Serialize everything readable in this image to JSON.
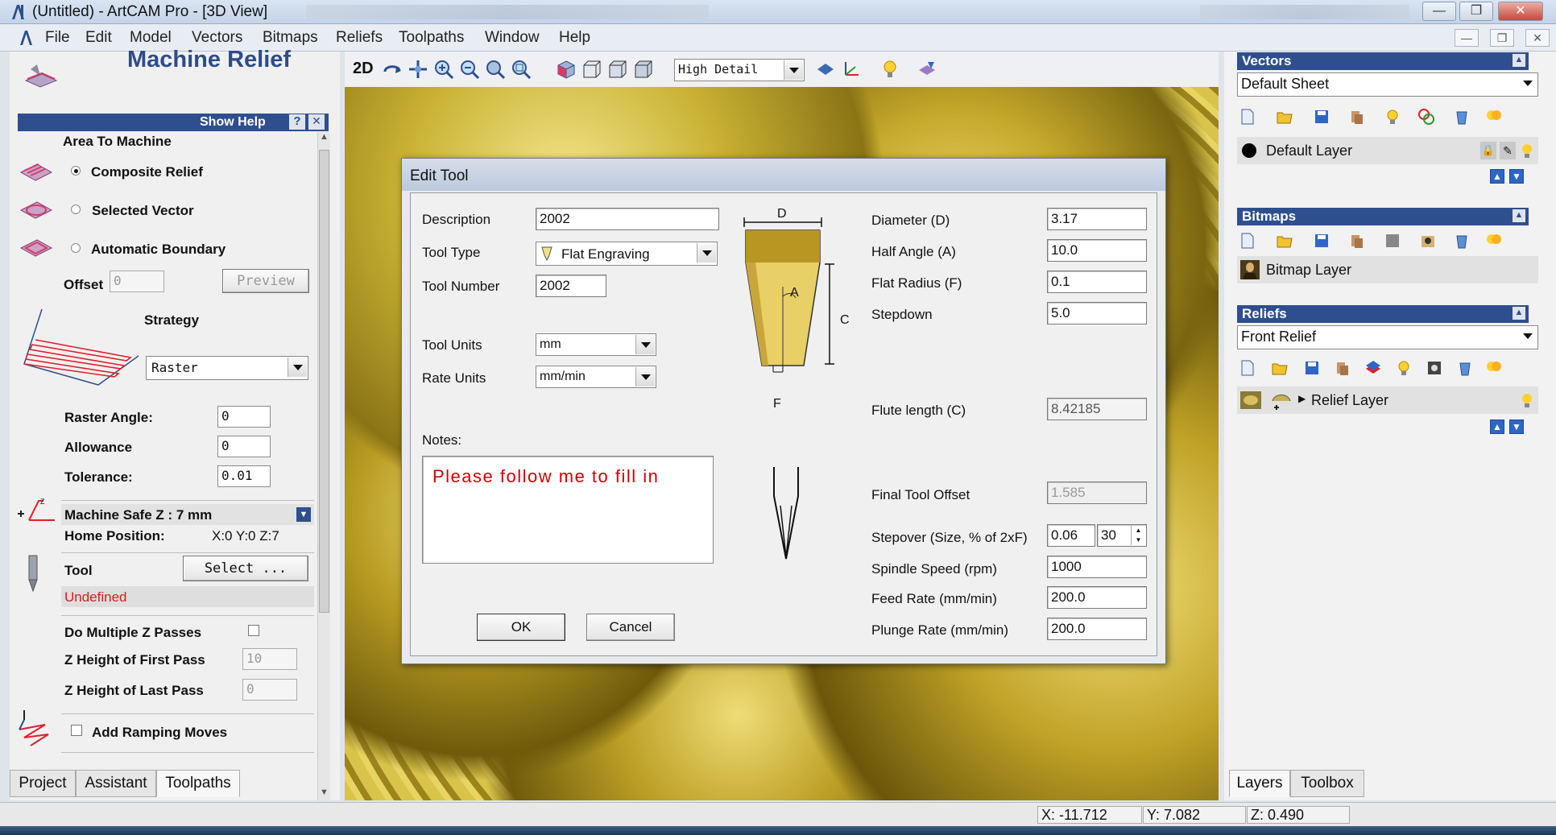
{
  "window": {
    "title": "(Untitled) - ArtCAM Pro - [3D View]",
    "minimize": "—",
    "maximize": "❐",
    "close": "✕"
  },
  "menu": [
    "File",
    "Edit",
    "Model",
    "Vectors",
    "Bitmaps",
    "Reliefs",
    "Toolpaths",
    "Window",
    "Help"
  ],
  "left": {
    "title": "Machine Relief",
    "show_help": "Show Help",
    "help_q": "?",
    "help_x": "✕",
    "area_to_machine": "Area To Machine",
    "composite_relief": "Composite Relief",
    "selected_vector": "Selected Vector",
    "automatic_boundary": "Automatic Boundary",
    "offset_label": "Offset",
    "offset_value": "0",
    "preview": "Preview",
    "strategy_label": "Strategy",
    "strategy_value": "Raster",
    "raster_angle_label": "Raster Angle:",
    "raster_angle_value": "0",
    "allowance_label": "Allowance",
    "allowance_value": "0",
    "tolerance_label": "Tolerance:",
    "tolerance_value": "0.01",
    "safe_z_label": "Machine Safe Z : 7 mm",
    "home_label": "Home Position:",
    "home_value": "X:0 Y:0 Z:7",
    "tool_label": "Tool",
    "select_button": "Select ...",
    "tool_status": "Undefined",
    "multi_z": "Do Multiple Z Passes",
    "first_pass_label": "Z Height of First Pass",
    "first_pass_value": "10",
    "last_pass_label": "Z Height of Last Pass",
    "last_pass_value": "0",
    "ramping": "Add Ramping Moves",
    "tabs": [
      "Project",
      "Assistant",
      "Toolpaths"
    ]
  },
  "toolbar": {
    "mode_2d": "2D",
    "detail": "High Detail"
  },
  "dialog": {
    "title": "Edit Tool",
    "description_label": "Description",
    "description_value": "2002",
    "tool_type_label": "Tool Type",
    "tool_type_value": "Flat Engraving",
    "tool_number_label": "Tool Number",
    "tool_number_value": "2002",
    "tool_units_label": "Tool Units",
    "tool_units_value": "mm",
    "rate_units_label": "Rate Units",
    "rate_units_value": "mm/min",
    "notes_label": "Notes:",
    "notes_value": "Please follow me to fill in",
    "ok": "OK",
    "cancel": "Cancel",
    "diagram_d": "D",
    "diagram_a": "A",
    "diagram_c": "C",
    "diagram_f": "F",
    "diameter_label": "Diameter (D)",
    "diameter_value": "3.17",
    "half_angle_label": "Half Angle (A)",
    "half_angle_value": "10.0",
    "flat_radius_label": "Flat Radius (F)",
    "flat_radius_value": "0.1",
    "stepdown_label": "Stepdown",
    "stepdown_value": "5.0",
    "flute_length_label": "Flute length (C)",
    "flute_length_value": "8.42185",
    "final_offset_label": "Final Tool Offset",
    "final_offset_value": "1.585",
    "stepover_label": "Stepover (Size, % of 2xF)",
    "stepover_size": "0.06",
    "stepover_pct": "30",
    "spindle_label": "Spindle Speed (rpm)",
    "spindle_value": "1000",
    "feed_label": "Feed Rate (mm/min)",
    "feed_value": "200.0",
    "plunge_label": "Plunge Rate (mm/min)",
    "plunge_value": "200.0"
  },
  "right": {
    "vectors_header": "Vectors",
    "vectors_sheet": "Default Sheet",
    "vectors_layer": "Default Layer",
    "bitmaps_header": "Bitmaps",
    "bitmap_layer": "Bitmap Layer",
    "reliefs_header": "Reliefs",
    "reliefs_combo": "Front Relief",
    "relief_layer": "Relief Layer",
    "tabs": [
      "Layers",
      "Toolbox"
    ]
  },
  "status": {
    "x": "X: -11.712",
    "y": "Y: 7.082",
    "z": "Z: 0.490"
  },
  "colors": {
    "accent": "#2d4f8e",
    "undefined_text": "#d22020",
    "notes_text": "#d40000",
    "relief_gold": "#c8ad2c"
  }
}
